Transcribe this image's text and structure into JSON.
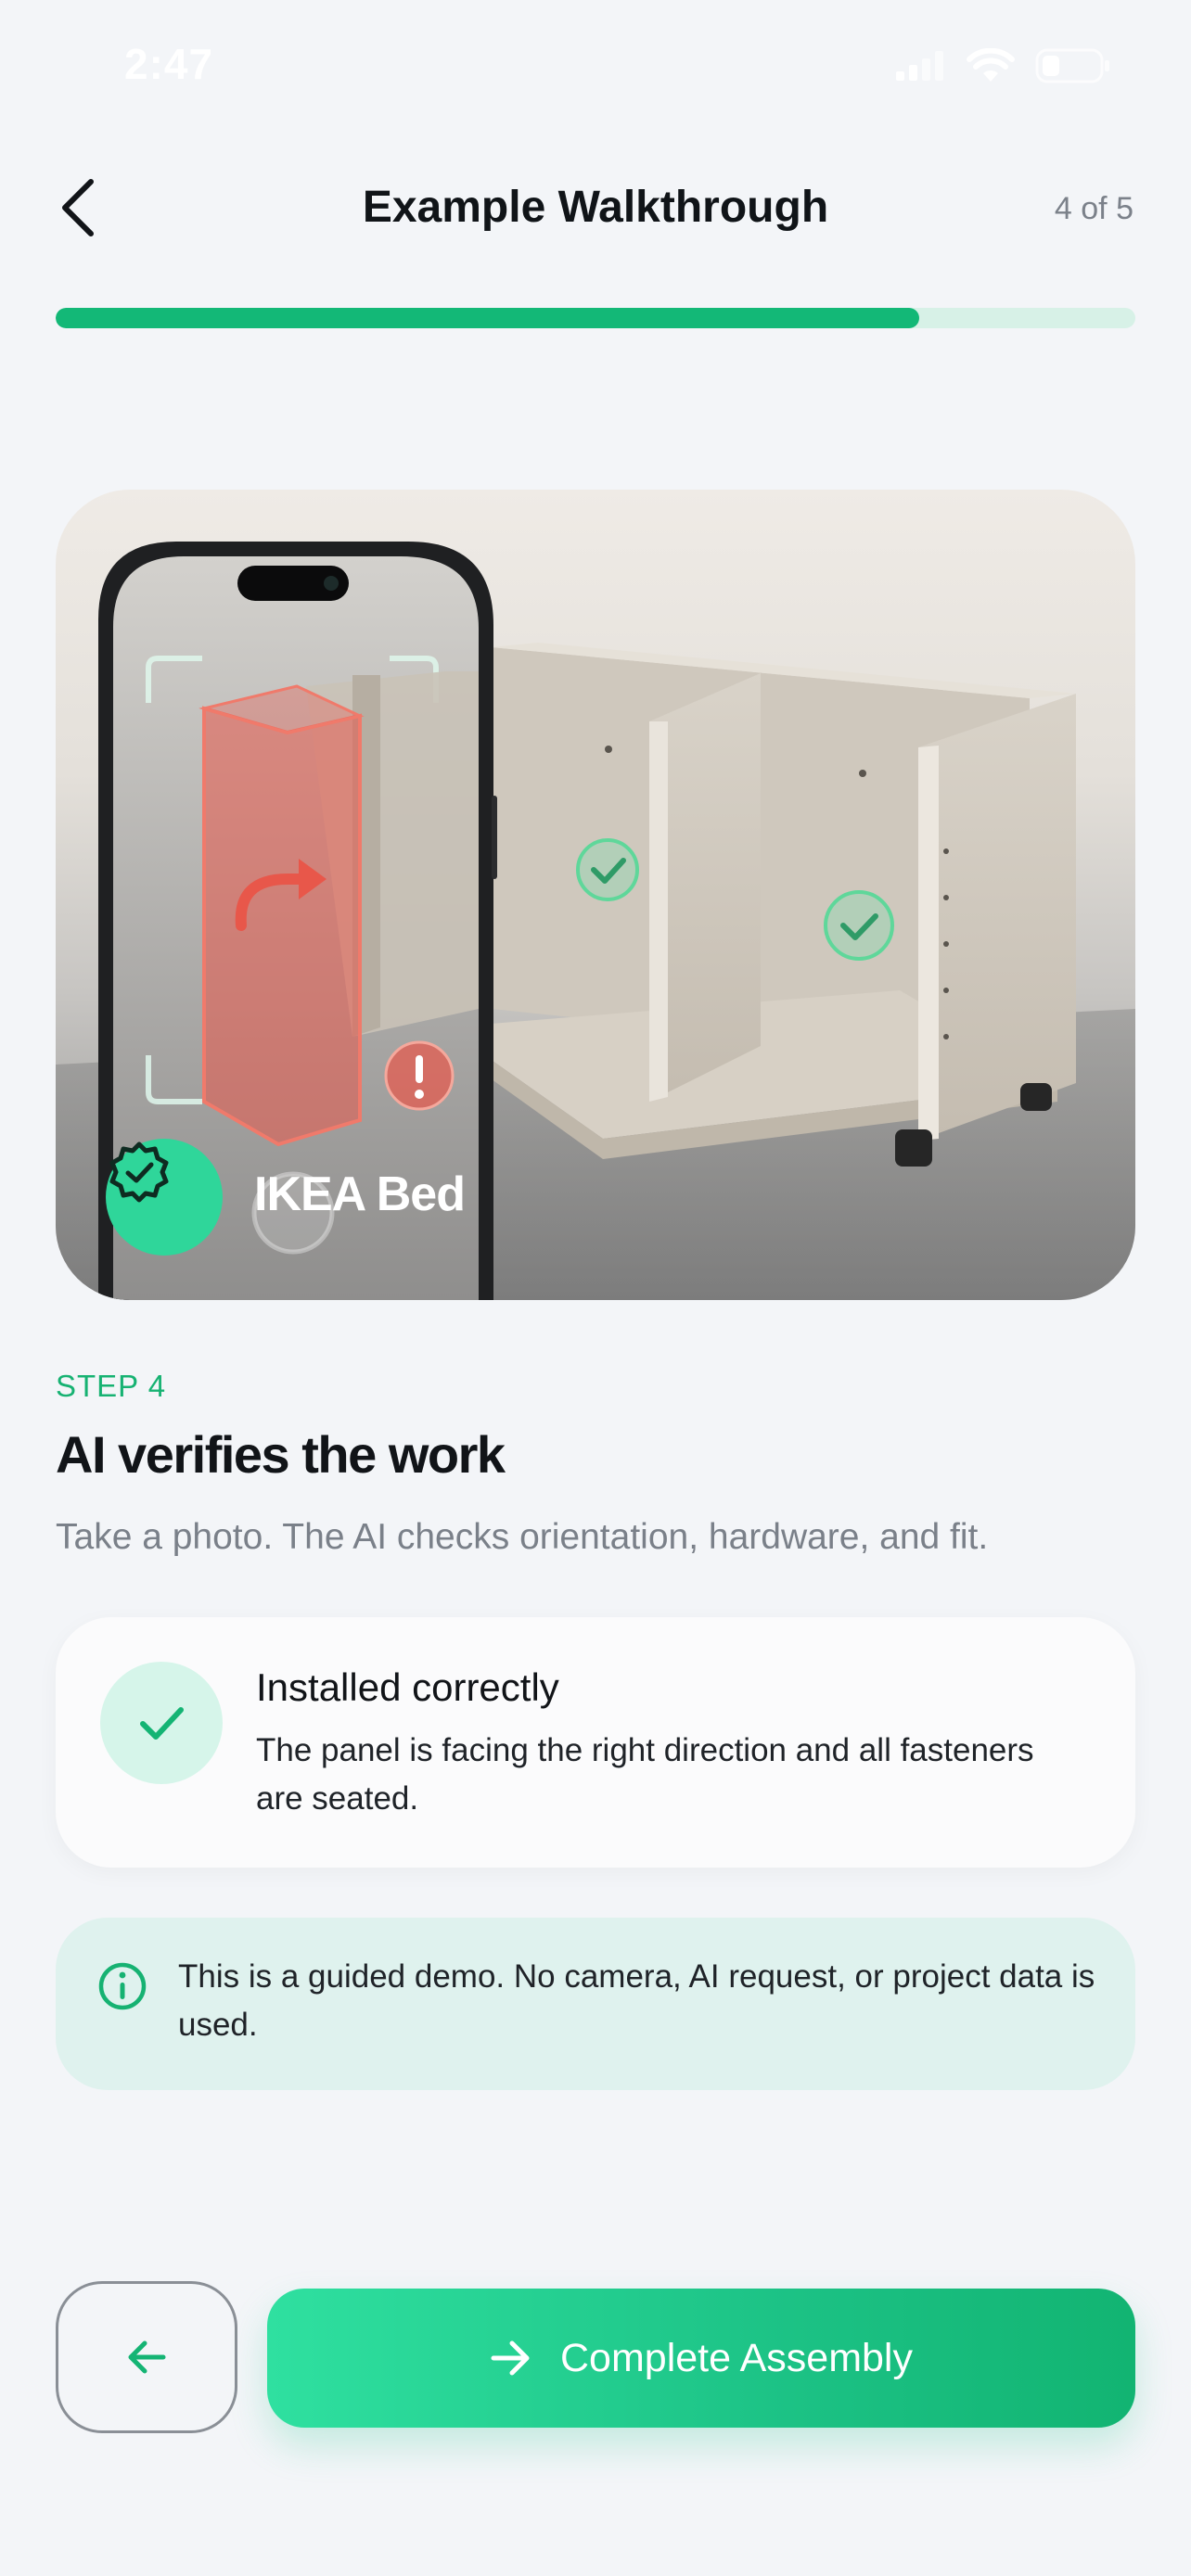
{
  "status_bar": {
    "time": "2:47",
    "icons": [
      "signal-icon",
      "wifi-icon",
      "battery-icon"
    ]
  },
  "header": {
    "title": "Example Walkthrough",
    "step_counter": "4 of 5",
    "progress_fraction": 0.8,
    "back_icon": "chevron-left-icon"
  },
  "hero": {
    "label": "IKEA Bed",
    "badge_icon": "verified-badge-icon",
    "colors": {
      "error": "#e8574a",
      "ok": "#5fd79a",
      "badge": "#2fd69a"
    }
  },
  "step": {
    "eyebrow": "STEP 4",
    "title": "AI verifies the work",
    "description": "Take a photo. The AI checks orientation, hardware, and fit."
  },
  "result": {
    "icon": "check-icon",
    "title": "Installed correctly",
    "text": "The panel is facing the right direction and all fasteners are seated."
  },
  "note": {
    "icon": "info-icon",
    "text": "This is a guided demo. No camera, AI request, or project data is used."
  },
  "actions": {
    "back_icon": "arrow-left-icon",
    "primary_icon": "arrow-right-icon",
    "primary_label": "Complete Assembly"
  },
  "colors": {
    "accent": "#13b877",
    "accent_light": "#d7f1e7",
    "background": "#f3f5f8"
  }
}
